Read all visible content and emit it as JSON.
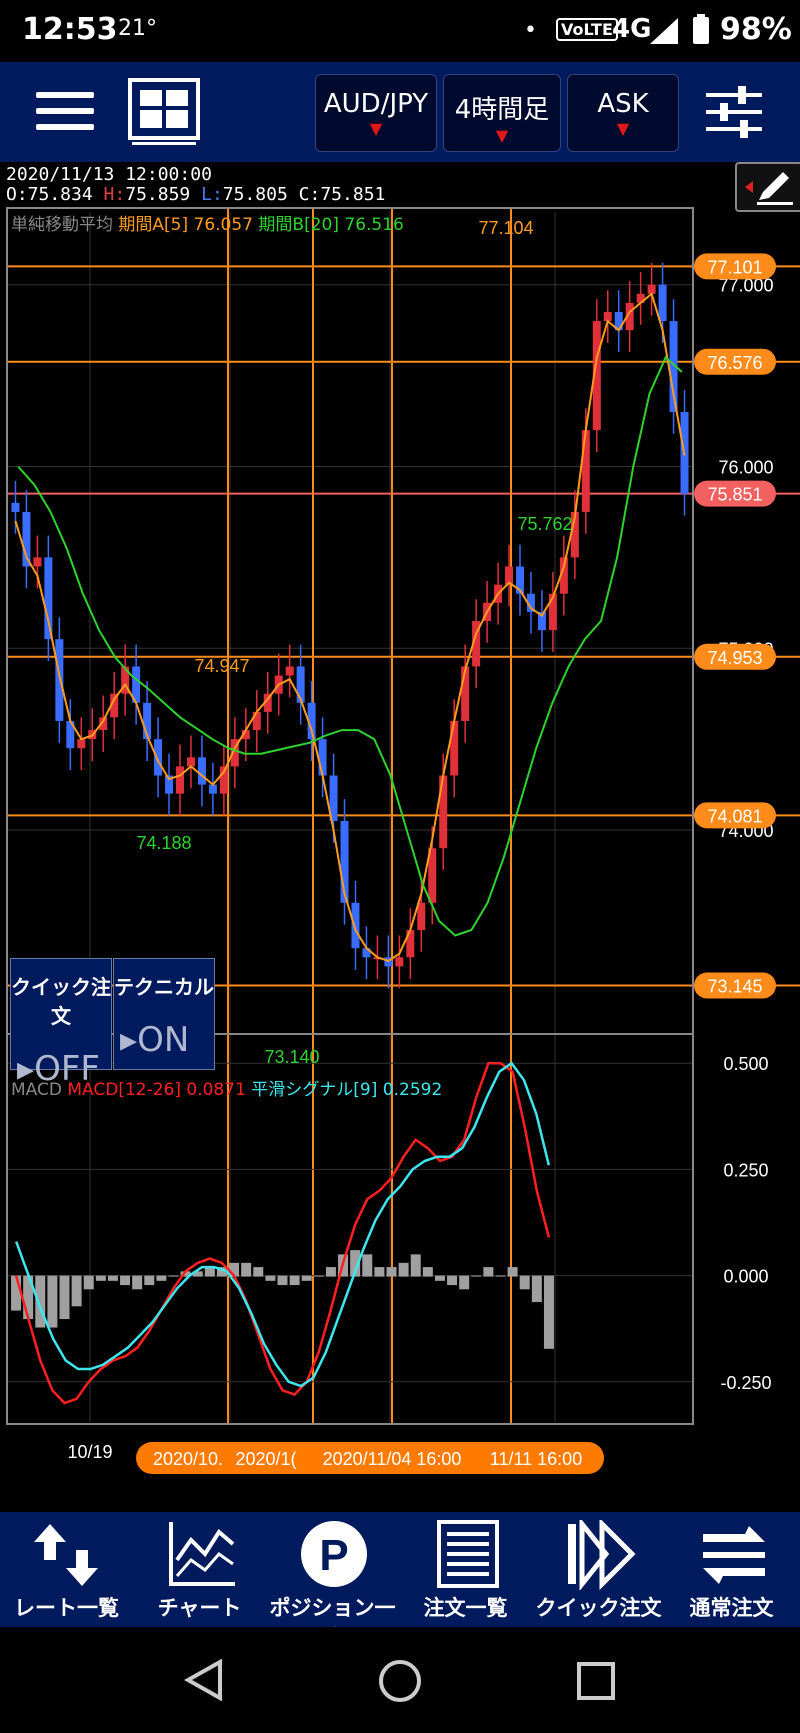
{
  "status_bar": {
    "time": "12:53",
    "temperature": "21°",
    "volte": "VoLTE",
    "network": "4G",
    "battery": "98%"
  },
  "toolbar": {
    "menu_icon": "hamburger-icon",
    "layout_icon": "grid-layout-icon",
    "symbol": "AUD/JPY",
    "timeframe": "4時間足",
    "price_side": "ASK",
    "settings_icon": "sliders-icon"
  },
  "ohlc": {
    "datetime": "2020/11/13 12:00:00",
    "open": "O:75.834",
    "high_label": "H:",
    "high": "75.859",
    "low_label": "L:",
    "low": "75.805",
    "close": "C:75.851"
  },
  "sma_legend": {
    "title": "単純移動平均",
    "a": "期間A[5] 76.057",
    "b": "期間B[20] 76.516"
  },
  "macd_legend": {
    "title": "MACD",
    "macd": "MACD[12-26] 0.0871",
    "signal": "平滑シグナル[9] 0.2592"
  },
  "price_axis": [
    "77.000",
    "76.000",
    "75.000",
    "74.000"
  ],
  "price_tags": [
    {
      "text": "77.101",
      "color": "#ff8c1a"
    },
    {
      "text": "76.576",
      "color": "#ff8c1a"
    },
    {
      "text": "75.851",
      "color": "#f26060"
    },
    {
      "text": "74.953",
      "color": "#ff8c1a"
    },
    {
      "text": "74.081",
      "color": "#ff8c1a"
    },
    {
      "text": "73.145",
      "color": "#ff8c1a"
    }
  ],
  "chart_annotations": {
    "high": "77.104",
    "local_high": "74.947",
    "local_low": "74.188",
    "low": "73.140",
    "last_low": "75.762"
  },
  "macd_axis": [
    "0.500",
    "0.250",
    "0.000",
    "-0.250"
  ],
  "date_axis": {
    "first": "10/19",
    "tags": [
      "2020/10.",
      "2020/1(",
      "2020/11/04 16:00",
      "11/11 16:00"
    ]
  },
  "quick_panel": {
    "quick_order": "クイック注文",
    "technical": "テクニカル",
    "quick_state": "OFF",
    "technical_state": "ON"
  },
  "bottom_nav": [
    {
      "label": "レート一覧",
      "icon": "rate-list-icon"
    },
    {
      "label": "チャート",
      "icon": "chart-icon"
    },
    {
      "label": "ポジション一覧",
      "icon": "position-icon"
    },
    {
      "label": "注文一覧",
      "icon": "order-list-icon"
    },
    {
      "label": "クイック注文",
      "icon": "quick-order-icon"
    },
    {
      "label": "通常注文",
      "icon": "normal-order-icon"
    }
  ],
  "colors": {
    "toolbar_bg": "#001a5e",
    "up_candle": "#e0303a",
    "down_candle": "#3a6cff",
    "sma_a": "#ff9c1e",
    "sma_b": "#2ed32e",
    "macd": "#ff2020",
    "signal": "#3ee6ee",
    "grid": "#333333",
    "hline": "#ff8c1a"
  },
  "chart_data": {
    "type": "line",
    "title": "AUD/JPY 4時間足",
    "ylim": [
      72.9,
      77.4
    ],
    "macd_ylim": [
      -0.34,
      0.55
    ],
    "candles_close": [
      75.75,
      75.45,
      75.5,
      75.05,
      74.6,
      74.45,
      74.5,
      74.55,
      74.62,
      74.75,
      74.9,
      74.7,
      74.5,
      74.3,
      74.2,
      74.35,
      74.4,
      74.25,
      74.2,
      74.35,
      74.5,
      74.55,
      74.65,
      74.75,
      74.85,
      74.9,
      74.7,
      74.5,
      74.3,
      74.05,
      73.6,
      73.35,
      73.3,
      73.3,
      73.25,
      73.3,
      73.45,
      73.6,
      73.9,
      74.3,
      74.6,
      74.9,
      75.15,
      75.25,
      75.35,
      75.45,
      75.3,
      75.2,
      75.1,
      75.3,
      75.5,
      75.75,
      76.2,
      76.8,
      76.85,
      76.75,
      76.9,
      76.95,
      77.0,
      76.8,
      76.3,
      75.85
    ],
    "series": [
      {
        "name": "期間A[5]",
        "values": [
          75.7,
          75.5,
          75.4,
          75.15,
          74.85,
          74.6,
          74.5,
          74.52,
          74.6,
          74.72,
          74.8,
          74.7,
          74.52,
          74.38,
          74.28,
          74.3,
          74.35,
          74.3,
          74.25,
          74.32,
          74.45,
          74.55,
          74.65,
          74.72,
          74.8,
          74.83,
          74.72,
          74.55,
          74.3,
          74.0,
          73.65,
          73.45,
          73.35,
          73.3,
          73.28,
          73.32,
          73.45,
          73.65,
          73.95,
          74.3,
          74.6,
          74.88,
          75.08,
          75.2,
          75.3,
          75.36,
          75.32,
          75.22,
          75.18,
          75.28,
          75.45,
          75.72,
          76.2,
          76.6,
          76.8,
          76.75,
          76.85,
          76.9,
          76.95,
          76.75,
          76.4,
          76.06
        ]
      },
      {
        "name": "期間B[20]",
        "values": [
          76.0,
          75.9,
          75.75,
          75.55,
          75.3,
          75.1,
          74.95,
          74.85,
          74.78,
          74.7,
          74.62,
          74.56,
          74.5,
          74.45,
          74.42,
          74.42,
          74.44,
          74.46,
          74.48,
          74.52,
          74.55,
          74.55,
          74.5,
          74.3,
          74.0,
          73.7,
          73.5,
          73.42,
          73.45,
          73.6,
          73.85,
          74.15,
          74.45,
          74.7,
          74.9,
          75.05,
          75.15,
          75.5,
          76.0,
          76.4,
          76.6,
          76.52
        ]
      }
    ],
    "macd_series": [
      {
        "name": "MACD[12-26]",
        "values": [
          0.0,
          -0.1,
          -0.2,
          -0.27,
          -0.3,
          -0.29,
          -0.25,
          -0.22,
          -0.2,
          -0.19,
          -0.17,
          -0.13,
          -0.08,
          -0.03,
          0.01,
          0.03,
          0.04,
          0.03,
          0.0,
          -0.06,
          -0.14,
          -0.22,
          -0.27,
          -0.28,
          -0.25,
          -0.18,
          -0.08,
          0.03,
          0.12,
          0.18,
          0.2,
          0.23,
          0.28,
          0.32,
          0.3,
          0.27,
          0.28,
          0.32,
          0.42,
          0.5,
          0.5,
          0.48,
          0.35,
          0.2,
          0.09
        ]
      },
      {
        "name": "平滑シグナル[9]",
        "values": [
          0.08,
          0.0,
          -0.08,
          -0.15,
          -0.2,
          -0.22,
          -0.22,
          -0.21,
          -0.19,
          -0.17,
          -0.14,
          -0.11,
          -0.07,
          -0.03,
          0.0,
          0.02,
          0.02,
          0.01,
          -0.03,
          -0.09,
          -0.16,
          -0.21,
          -0.25,
          -0.26,
          -0.24,
          -0.18,
          -0.1,
          -0.02,
          0.06,
          0.13,
          0.18,
          0.21,
          0.25,
          0.27,
          0.28,
          0.28,
          0.3,
          0.35,
          0.42,
          0.48,
          0.5,
          0.46,
          0.38,
          0.26
        ]
      }
    ]
  }
}
